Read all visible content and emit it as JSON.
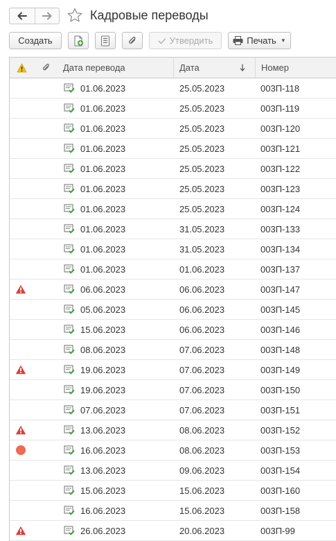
{
  "window": {
    "title": "Кадровые переводы"
  },
  "toolbar": {
    "create_label": "Создать",
    "approve_label": "Утвердить",
    "print_label": "Печать"
  },
  "table": {
    "columns": {
      "transfer_date": "Дата перевода",
      "date": "Дата",
      "number": "Номер"
    },
    "sort": "date-descending-arrow",
    "rows": [
      {
        "transfer_date": "01.06.2023",
        "date": "25.05.2023",
        "number": "003П-118",
        "status": ""
      },
      {
        "transfer_date": "01.06.2023",
        "date": "25.05.2023",
        "number": "003П-119",
        "status": ""
      },
      {
        "transfer_date": "01.06.2023",
        "date": "25.05.2023",
        "number": "003П-120",
        "status": ""
      },
      {
        "transfer_date": "01.06.2023",
        "date": "25.05.2023",
        "number": "003П-121",
        "status": ""
      },
      {
        "transfer_date": "01.06.2023",
        "date": "25.05.2023",
        "number": "003П-122",
        "status": ""
      },
      {
        "transfer_date": "01.06.2023",
        "date": "25.05.2023",
        "number": "003П-123",
        "status": ""
      },
      {
        "transfer_date": "01.06.2023",
        "date": "25.05.2023",
        "number": "003П-124",
        "status": ""
      },
      {
        "transfer_date": "01.06.2023",
        "date": "31.05.2023",
        "number": "003П-133",
        "status": ""
      },
      {
        "transfer_date": "01.06.2023",
        "date": "31.05.2023",
        "number": "003П-134",
        "status": ""
      },
      {
        "transfer_date": "01.06.2023",
        "date": "01.06.2023",
        "number": "003П-137",
        "status": ""
      },
      {
        "transfer_date": "06.06.2023",
        "date": "06.06.2023",
        "number": "003П-147",
        "status": "warning"
      },
      {
        "transfer_date": "05.06.2023",
        "date": "06.06.2023",
        "number": "003П-145",
        "status": ""
      },
      {
        "transfer_date": "15.06.2023",
        "date": "06.06.2023",
        "number": "003П-146",
        "status": ""
      },
      {
        "transfer_date": "08.06.2023",
        "date": "07.06.2023",
        "number": "003П-148",
        "status": ""
      },
      {
        "transfer_date": "19.06.2023",
        "date": "07.06.2023",
        "number": "003П-149",
        "status": "warning"
      },
      {
        "transfer_date": "19.06.2023",
        "date": "07.06.2023",
        "number": "003П-150",
        "status": ""
      },
      {
        "transfer_date": "07.06.2023",
        "date": "07.06.2023",
        "number": "003П-151",
        "status": ""
      },
      {
        "transfer_date": "13.06.2023",
        "date": "08.06.2023",
        "number": "003П-152",
        "status": "warning"
      },
      {
        "transfer_date": "16.06.2023",
        "date": "08.06.2023",
        "number": "003П-153",
        "status": "dot"
      },
      {
        "transfer_date": "13.06.2023",
        "date": "09.06.2023",
        "number": "003П-154",
        "status": ""
      },
      {
        "transfer_date": "15.06.2023",
        "date": "15.06.2023",
        "number": "003П-160",
        "status": ""
      },
      {
        "transfer_date": "16.06.2023",
        "date": "15.06.2023",
        "number": "003П-158",
        "status": ""
      },
      {
        "transfer_date": "26.06.2023",
        "date": "20.06.2023",
        "number": "003П-99",
        "status": "warning"
      }
    ]
  },
  "colors": {
    "warning_red": "#d9403a",
    "warning_yellow": "#f1c40f",
    "dot_orange": "#ef6a52",
    "doc_green": "#3aa53a"
  },
  "icons": {
    "back": "arrow-left-icon",
    "forward": "arrow-right-icon",
    "favorite": "star-icon",
    "create_from": "document-add-icon",
    "list": "list-icon",
    "attach": "paperclip-icon",
    "print": "printer-icon",
    "row": "approved-document-icon"
  }
}
